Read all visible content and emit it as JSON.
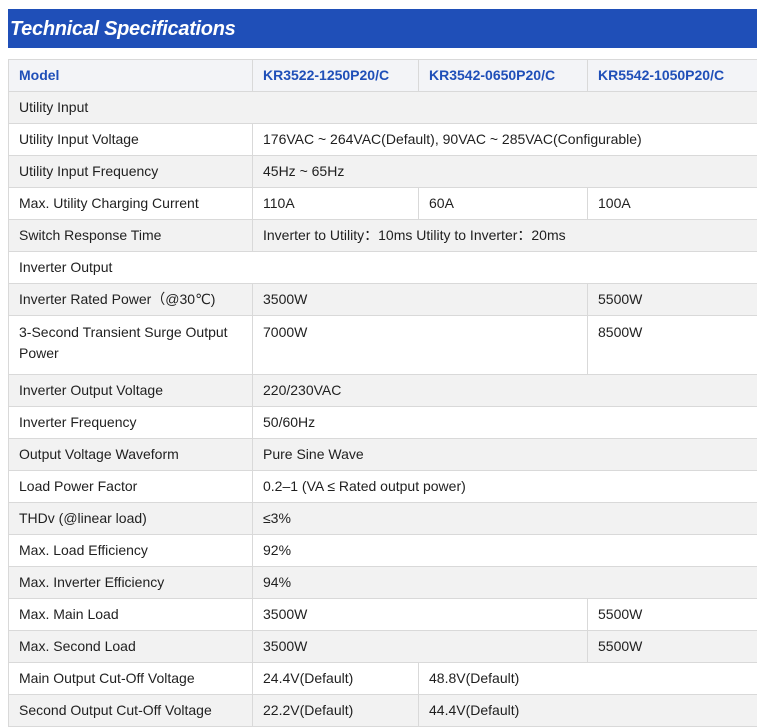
{
  "title": "Technical Specifications",
  "header": [
    "Model",
    "KR3522-1250P20/C",
    "KR3542-0650P20/C",
    "KR5542-1050P20/C"
  ],
  "rows": [
    {
      "label": "Utility Input",
      "cells": []
    },
    {
      "label": "Utility Input Voltage",
      "cells": [
        {
          "text": "176VAC ~ 264VAC(Default), 90VAC ~ 285VAC(Configurable)",
          "span": 3
        }
      ]
    },
    {
      "label": "Utility Input Frequency",
      "cells": [
        {
          "text": "45Hz ~ 65Hz",
          "span": 3
        }
      ]
    },
    {
      "label": "Max. Utility Charging Current",
      "cells": [
        {
          "text": "110A",
          "span": 1
        },
        {
          "text": "60A",
          "span": 1
        },
        {
          "text": "100A",
          "span": 1
        }
      ]
    },
    {
      "label": "Switch Response Time",
      "cells": [
        {
          "text": "Inverter to Utility：10ms Utility to Inverter：20ms",
          "span": 3
        }
      ]
    },
    {
      "label": "Inverter Output",
      "cells": []
    },
    {
      "label": "Inverter Rated Power（@30℃)",
      "cells": [
        {
          "text": "3500W",
          "span": 2
        },
        {
          "text": "5500W",
          "span": 1
        }
      ]
    },
    {
      "label": "3-Second Transient Surge Output Power",
      "tall": true,
      "cells": [
        {
          "text": "7000W",
          "span": 2
        },
        {
          "text": "8500W",
          "span": 1
        }
      ]
    },
    {
      "label": "Inverter Output Voltage",
      "cells": [
        {
          "text": "220/230VAC",
          "span": 3
        }
      ]
    },
    {
      "label": "Inverter Frequency",
      "cells": [
        {
          "text": "50/60Hz",
          "span": 3
        }
      ]
    },
    {
      "label": "Output Voltage Waveform",
      "cells": [
        {
          "text": "Pure Sine Wave",
          "span": 3
        }
      ]
    },
    {
      "label": "Load Power Factor",
      "cells": [
        {
          "text": "0.2–1 (VA ≤ Rated output power)",
          "span": 3
        }
      ]
    },
    {
      "label": "THDv (@linear load)",
      "cells": [
        {
          "text": "≤3%",
          "span": 3
        }
      ]
    },
    {
      "label": "Max. Load Efficiency",
      "cells": [
        {
          "text": "92%",
          "span": 3
        }
      ]
    },
    {
      "label": "Max. Inverter Efficiency",
      "cells": [
        {
          "text": "94%",
          "span": 3
        }
      ]
    },
    {
      "label": "Max. Main Load",
      "cells": [
        {
          "text": "3500W",
          "span": 2
        },
        {
          "text": "5500W",
          "span": 1
        }
      ]
    },
    {
      "label": "Max. Second Load",
      "cells": [
        {
          "text": "3500W",
          "span": 2
        },
        {
          "text": "5500W",
          "span": 1
        }
      ]
    },
    {
      "label": "Main Output Cut-Off Voltage",
      "cells": [
        {
          "text": "24.4V(Default)",
          "span": 1
        },
        {
          "text": "48.8V(Default)",
          "span": 2
        }
      ]
    },
    {
      "label": "Second Output Cut-Off Voltage",
      "cells": [
        {
          "text": "22.2V(Default)",
          "span": 1
        },
        {
          "text": "44.4V(Default)",
          "span": 2
        }
      ]
    }
  ]
}
